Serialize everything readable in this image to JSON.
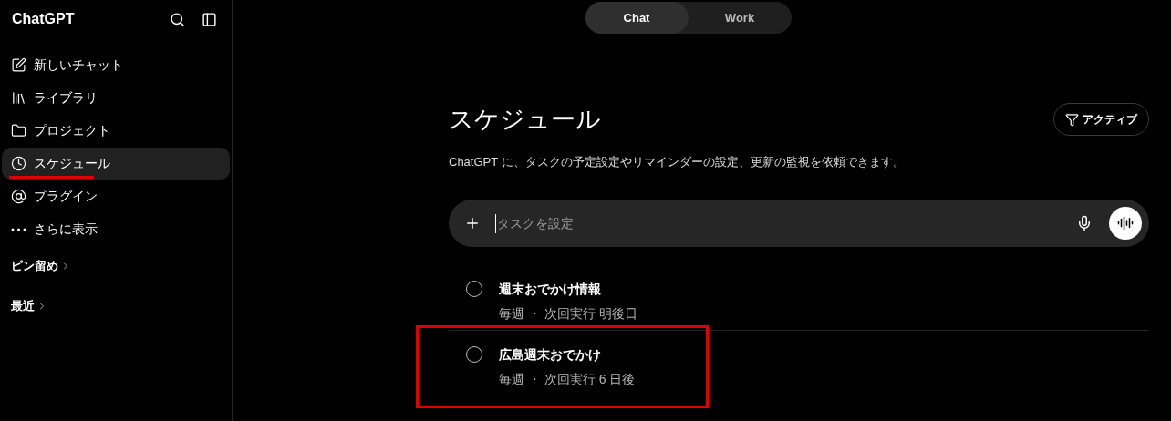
{
  "sidebar": {
    "brand": "ChatGPT",
    "items": [
      {
        "label": "新しいチャット",
        "selected": false,
        "marked": false
      },
      {
        "label": "ライブラリ",
        "selected": false,
        "marked": false
      },
      {
        "label": "プロジェクト",
        "selected": false,
        "marked": false
      },
      {
        "label": "スケジュール",
        "selected": true,
        "marked": true
      },
      {
        "label": "プラグイン",
        "selected": false,
        "marked": false
      },
      {
        "label": "さらに表示",
        "selected": false,
        "marked": false
      }
    ],
    "sections": [
      {
        "label": "ピン留め"
      },
      {
        "label": "最近"
      }
    ]
  },
  "mode_tabs": [
    {
      "label": "Chat",
      "selected": true
    },
    {
      "label": "Work",
      "selected": false
    }
  ],
  "page": {
    "title": "スケジュール",
    "filter": "アクティブ",
    "description": "ChatGPT に、タスクの予定設定やリマインダーの設定、更新の監視を依頼できます。"
  },
  "composer": {
    "placeholder": "タスクを設定"
  },
  "tasks": [
    {
      "title": "週末おでかけ情報",
      "schedule": "毎週 ・ 次回実行 明後日",
      "checked": false,
      "marked": false
    },
    {
      "title": "広島週末おでかけ",
      "schedule": "毎週 ・ 次回実行 6 日後",
      "checked": false,
      "marked": true
    }
  ]
}
